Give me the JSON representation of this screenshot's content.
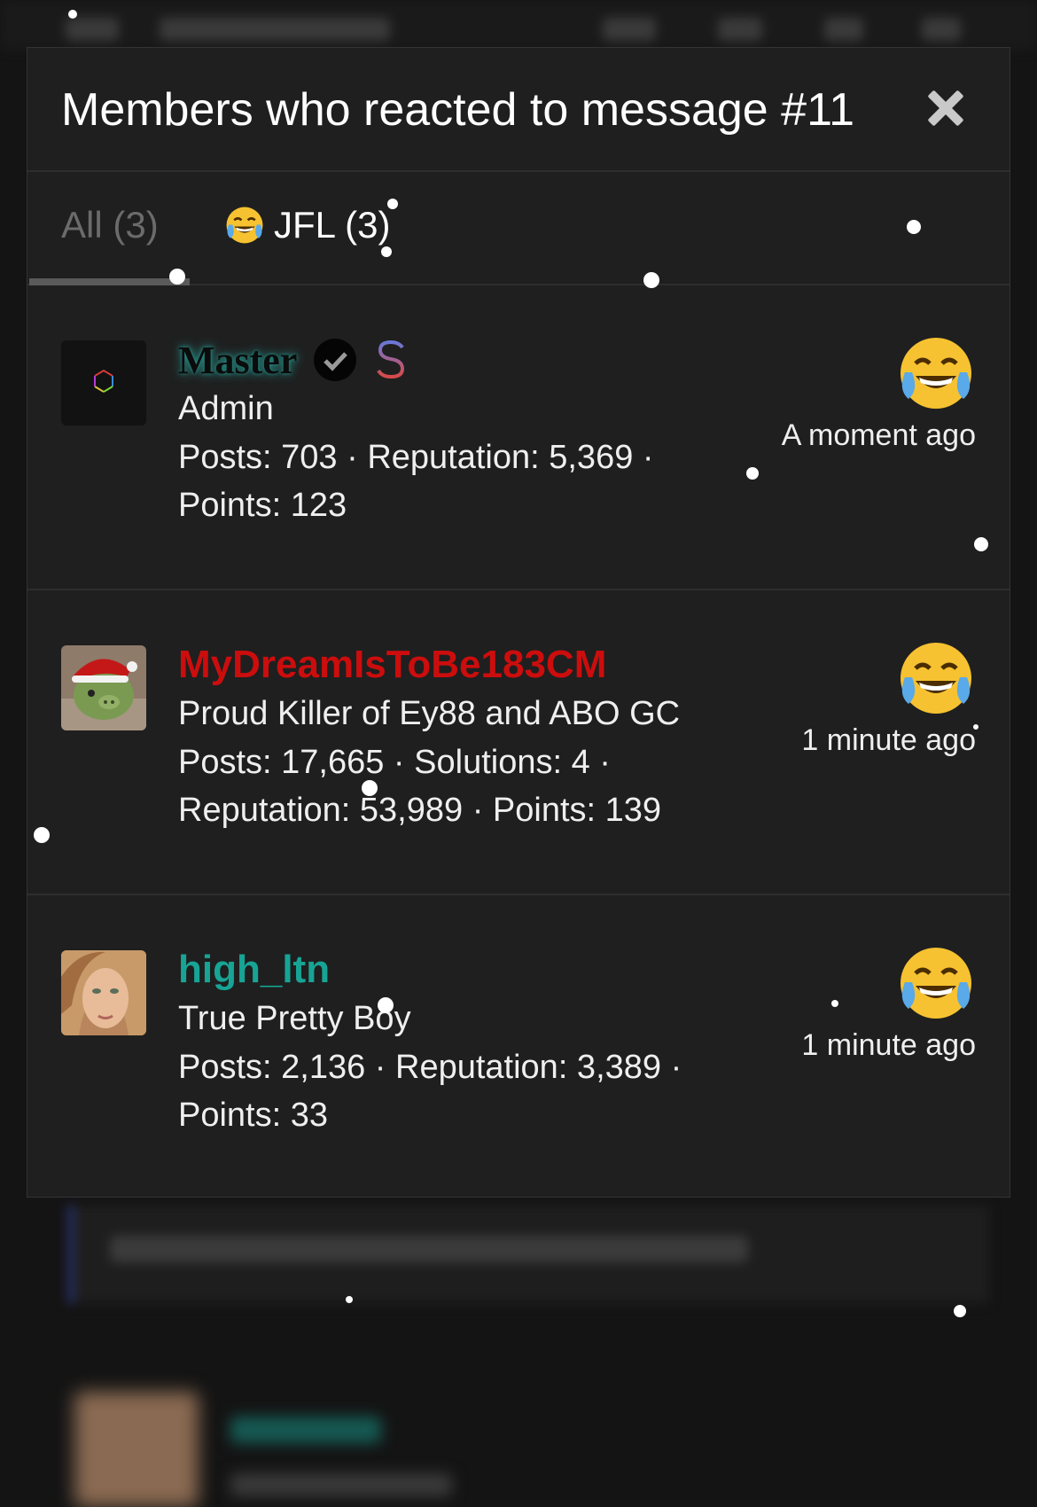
{
  "modal": {
    "title": "Members who reacted to message #11",
    "close_icon": "close-icon"
  },
  "tabs": [
    {
      "label": "All (3)",
      "active": false
    },
    {
      "label": "JFL (3)",
      "icon": "crying-laughing-emoji-icon",
      "active": true
    }
  ],
  "members": [
    {
      "username": "Master",
      "badges": [
        "verified-check-icon",
        "dollar-sign-icon"
      ],
      "user_title": "Admin",
      "stats_line1": "Posts: 703 · Reputation: 5,369 ·",
      "stats_line2": "Points: 123",
      "reaction_icon": "crying-laughing-emoji-icon",
      "time": "A moment ago",
      "name_color": "#0b0b0b"
    },
    {
      "username": "MyDreamIsToBe183CM",
      "user_title": "Proud Killer of Ey88 and ABO GC",
      "stats_line1": "Posts: 17,665 · Solutions: 4 ·",
      "stats_line2": "Reputation: 53,989 · Points: 139",
      "reaction_icon": "crying-laughing-emoji-icon",
      "time": "1 minute ago",
      "name_color": "#cc0d0d"
    },
    {
      "username": "high_ltn",
      "user_title": "True Pretty Boy",
      "stats_line1": "Posts: 2,136 · Reputation: 3,389 ·",
      "stats_line2": "Points: 33",
      "reaction_icon": "crying-laughing-emoji-icon",
      "time": "1 minute ago",
      "name_color": "#17a495"
    }
  ],
  "colors": {
    "modal_bg": "#1f1f1f",
    "page_bg": "#141414",
    "text": "#efefef",
    "muted_tab": "#6b6b6b"
  }
}
